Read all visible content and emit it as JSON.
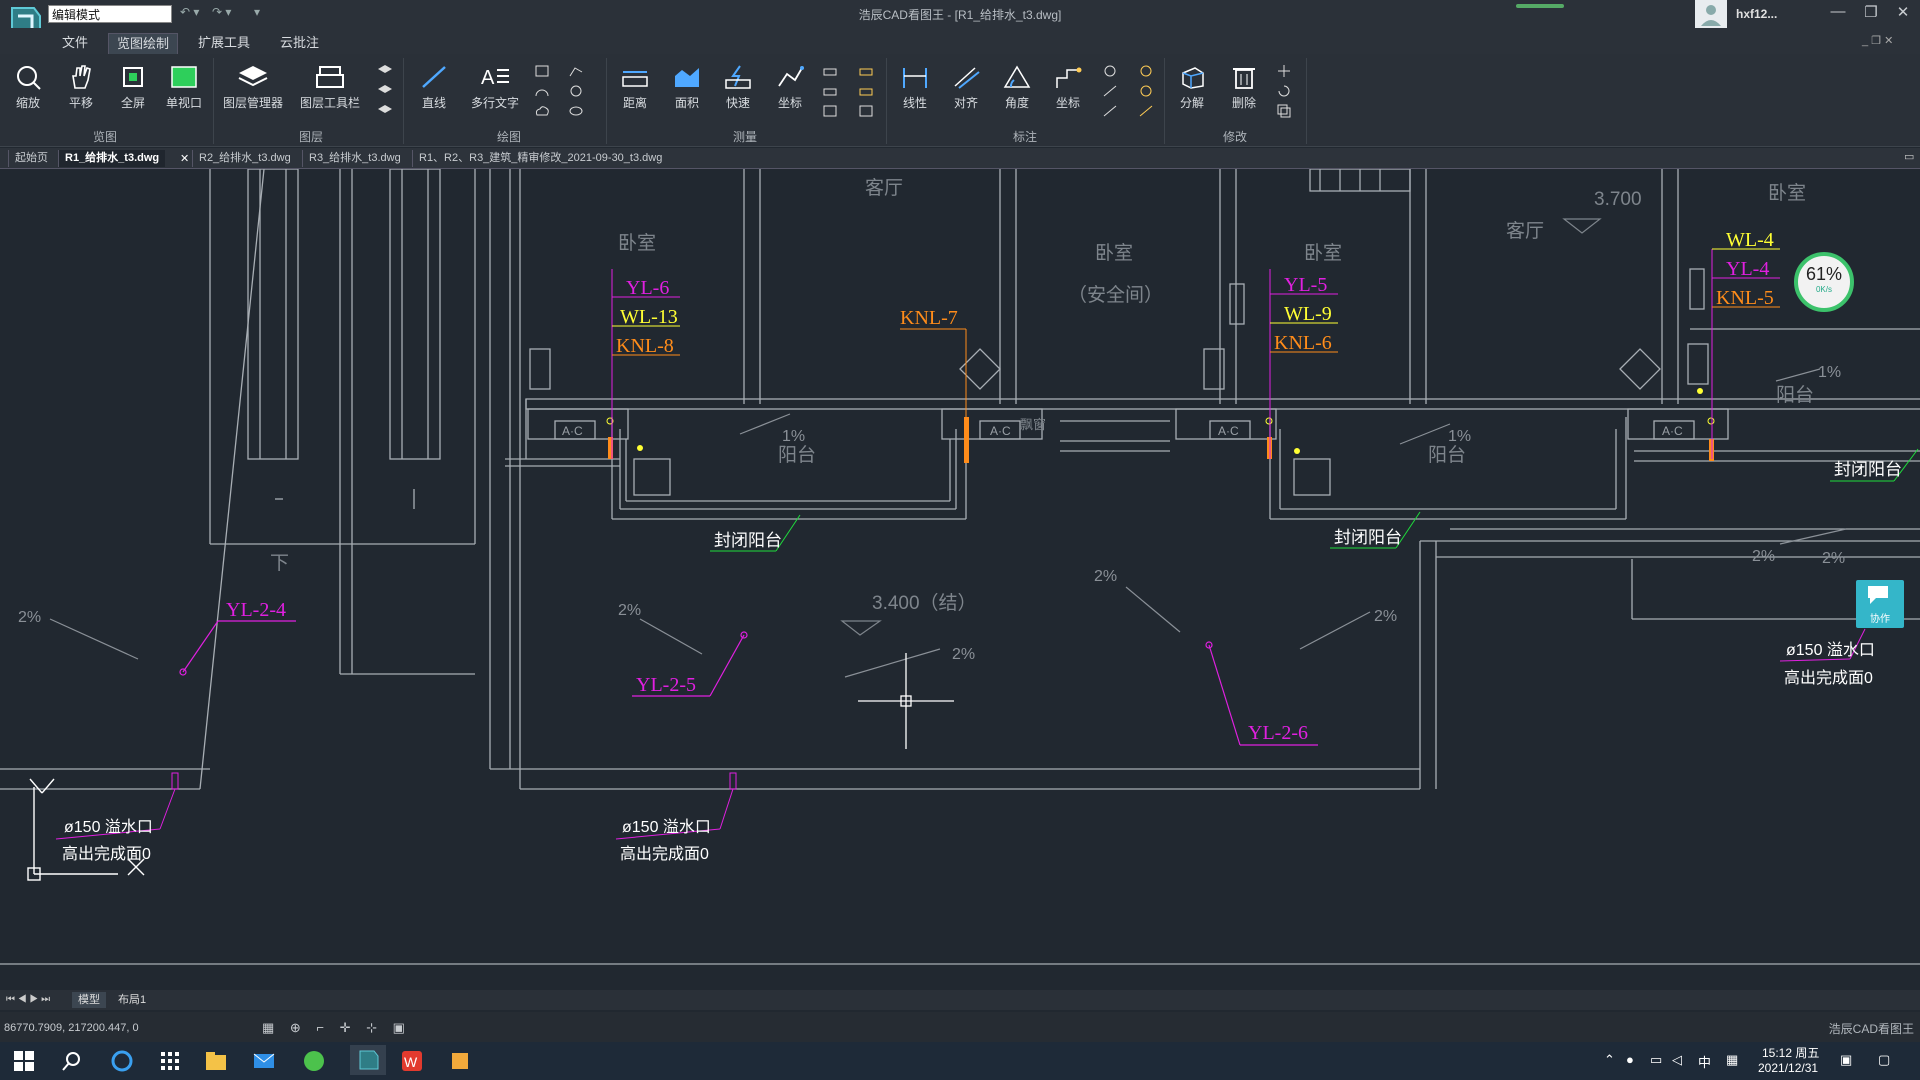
{
  "titlebar": {
    "mode": "编辑模式",
    "window_title": "浩辰CAD看图王 - [R1_给排水_t3.dwg]",
    "user": "hxf12..."
  },
  "menu": [
    "文件",
    "览图绘制",
    "扩展工具",
    "云批注"
  ],
  "ribbon": {
    "tools": [
      "缩放",
      "平移",
      "全屏",
      "单视口",
      "图层管理器",
      "图层工具栏",
      "直线",
      "多行文字",
      "距离",
      "面积",
      "快速",
      "坐标",
      "线性",
      "对齐",
      "角度",
      "坐标",
      "分解",
      "删除"
    ],
    "groups": [
      "览图",
      "图层",
      "绘图",
      "测量",
      "标注",
      "修改"
    ]
  },
  "doc_tabs": [
    "起始页",
    "R1_给排水_t3.dwg",
    "R2_给排水_t3.dwg",
    "R3_给排水_t3.dwg",
    "R1、R2、R3_建筑_精审修改_2021-09-30_t3.dwg"
  ],
  "drawing": {
    "rooms": [
      "客厅",
      "卧室",
      "卧室",
      "（安全间）",
      "卧室",
      "客厅",
      "卧室",
      "阳台",
      "阳台",
      "阳台",
      "下"
    ],
    "elevations": [
      "3.700",
      "3.400（结）"
    ],
    "slopes": [
      "1%",
      "1%",
      "1%",
      "2%",
      "2%",
      "2%",
      "2%",
      "2%",
      "2%",
      "2%"
    ],
    "pipe_labels": {
      "yl6": "YL-6",
      "wl13": "WL-13",
      "knl8": "KNL-8",
      "knl7": "KNL-7",
      "yl5": "YL-5",
      "wl9": "WL-9",
      "knl6": "KNL-6",
      "wl4": "WL-4",
      "yl4": "YL-4",
      "knl5": "KNL-5",
      "yl24": "YL-2-4",
      "yl25": "YL-2-5",
      "yl26": "YL-2-6"
    },
    "balcony_labels": [
      "封闭阳台",
      "封闭阳台",
      "封闭阳台"
    ],
    "ac": "A·C",
    "overflow": "ø150  溢水口",
    "overflow_note": "高出完成面0"
  },
  "widgets": {
    "speed_pct": "61%",
    "speed_rate": "0K/s",
    "collab": "协作"
  },
  "layout_tabs": [
    "模型",
    "布局1"
  ],
  "status": {
    "coords": "86770.7909, 217200.447, 0",
    "app": "浩辰CAD看图王"
  },
  "taskbar": {
    "time": "15:12 周五",
    "date": "2021/12/31",
    "ime": "中"
  },
  "colors": {
    "magenta": "#e020e0",
    "yellow": "#ffff33",
    "orange": "#ff8c1a",
    "green": "#1fdc3c",
    "line": "#c8ccd0",
    "dim": "#8a9097"
  }
}
